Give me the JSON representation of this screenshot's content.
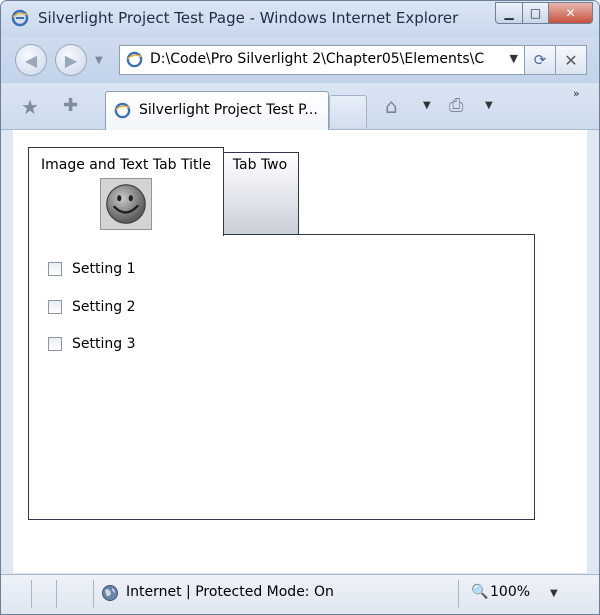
{
  "window": {
    "title": "Silverlight Project Test Page - Windows Internet Explorer",
    "minimize_glyph": "▁",
    "maximize_glyph": "□",
    "close_glyph": "✕"
  },
  "nav": {
    "back_glyph": "◀",
    "forward_glyph": "▶",
    "recent_pages_glyph": "▼",
    "address": "D:\\Code\\Pro Silverlight 2\\Chapter05\\Elements\\C",
    "address_dropdown_glyph": "▼",
    "refresh_glyph": "⟳",
    "stop_glyph": "✕"
  },
  "command_bar": {
    "favorites_glyph": "★",
    "add_favorites_glyph": "✚",
    "tab_title": "Silverlight Project Test P...",
    "home_glyph": "⌂",
    "dropdown_glyph": "▼",
    "print_glyph": "⎙",
    "more_glyph": "»"
  },
  "silverlight": {
    "tabs": [
      {
        "label": "Image and Text Tab Title",
        "selected": true
      },
      {
        "label": "Tab Two",
        "selected": false
      }
    ],
    "settings": [
      {
        "label": "Setting 1",
        "checked": false
      },
      {
        "label": "Setting 2",
        "checked": false
      },
      {
        "label": "Setting 3",
        "checked": false
      }
    ]
  },
  "status": {
    "zone": "Internet | Protected Mode: On",
    "zoom_glyph": "🔍",
    "zoom": "100%",
    "zoom_dropdown_glyph": "▼"
  },
  "icons": {
    "app": "ie-logo-icon",
    "page": "ie-page-icon",
    "zone": "globe-icon",
    "tab_image": "smiley-face-icon"
  },
  "colors": {
    "chrome": "#dfe8f3",
    "close_button": "#c5523e",
    "tab_border": "#30384a"
  }
}
